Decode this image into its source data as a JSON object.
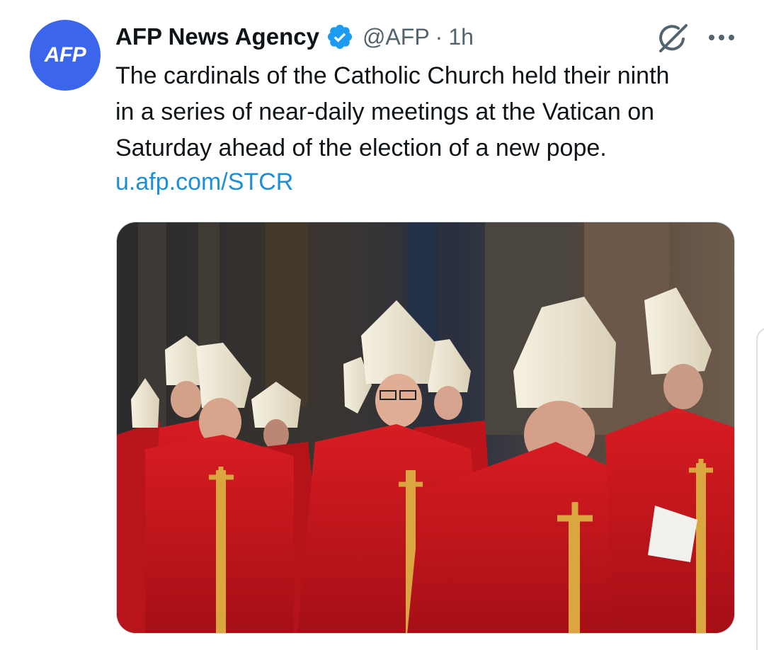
{
  "tweet": {
    "avatar_label": "AFP",
    "display_name": "AFP News Agency",
    "handle": "@AFP",
    "separator": "·",
    "time": "1h",
    "text_lines": [
      "The cardinals of the Catholic Church held their ninth",
      "in a series of near-daily meetings at the Vatican on",
      "Saturday ahead of the election of a new pope."
    ],
    "link": "u.afp.com/STCR"
  },
  "icons": {
    "verified": "verified-badge-icon",
    "grok": "grok-icon",
    "more": "more-horizontal-icon"
  },
  "colors": {
    "avatar_bg": "#3b66ec",
    "verified": "#1d9bf0",
    "link": "#1d8fd8",
    "secondary_text": "#536471",
    "robe_red": "#c8141c",
    "mitre_cream": "#efe9d6",
    "embroidery_gold": "#d9a640"
  }
}
